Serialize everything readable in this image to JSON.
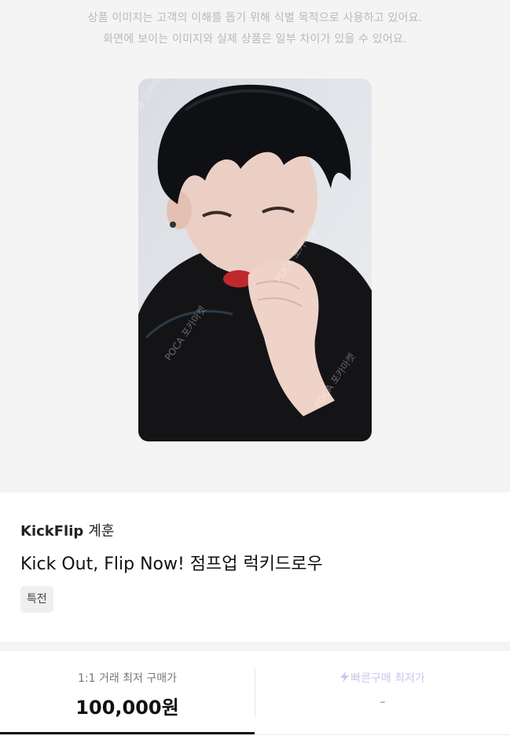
{
  "notice": {
    "line1": "상품 이미지는 고객의 이해를 돕기 위해 식별 목적으로 사용하고 있어요.",
    "line2": "화면에 보이는 이미지와 실제 상품은 일부 차이가 있을 수 있어요."
  },
  "product": {
    "image_alt": "photocard",
    "watermark": "POCA 포카마켓",
    "brand": "KickFlip",
    "member": "계훈",
    "title": "Kick Out, Flip Now! 점프업 럭키드로우",
    "tag": "특전"
  },
  "prices": {
    "left": {
      "label": "1:1 거래 최저 구매가",
      "value": "100,000원",
      "active": true
    },
    "right": {
      "label": "빠른구매 최저가",
      "value": "-",
      "icon": "lightning-icon",
      "active": false
    }
  },
  "colors": {
    "background_gray": "#f4f4f5",
    "text_primary": "#111111",
    "fast_buy_label": "#c7c7ee",
    "tab_underline": "#111111"
  }
}
